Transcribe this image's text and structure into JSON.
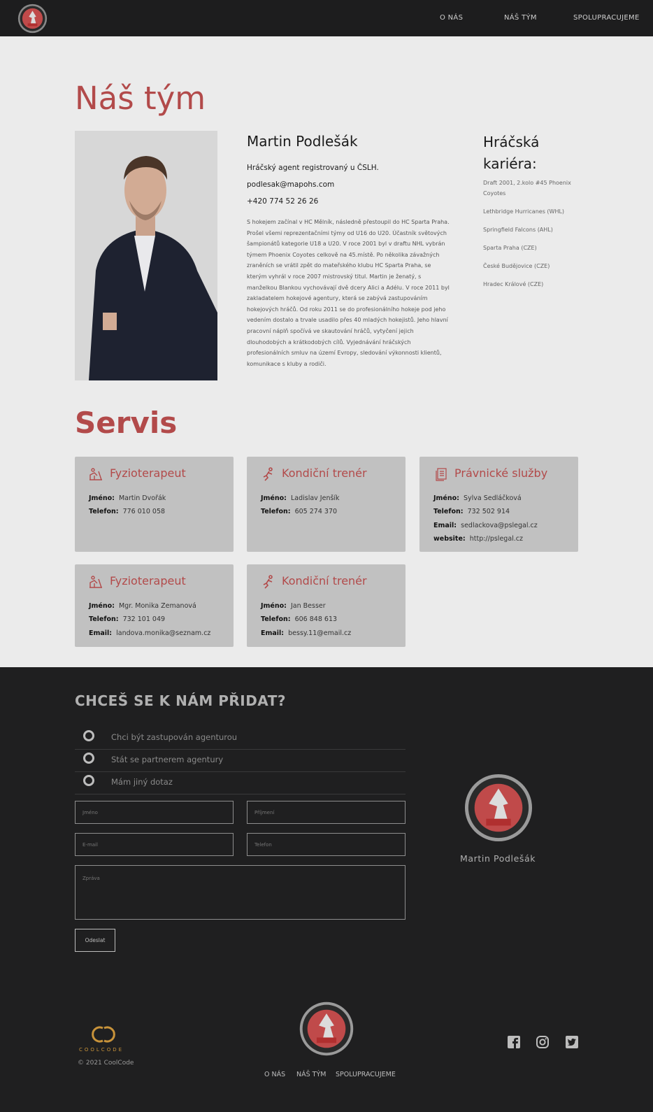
{
  "header": {
    "nav": [
      "O NÁS",
      "NÁŠ TÝM",
      "SPOLUPRACUJEME"
    ]
  },
  "team": {
    "heading": "Náš tým",
    "name": "Martin Podlešák",
    "subtitle": "Hráčský agent registrovaný u ČSLH.",
    "email": "podlesak@mapohs.com",
    "phone": "+420 774 52 26 26",
    "bio": "S hokejem začínal v HC Mělník, následně přestoupil do HC Sparta Praha. Prošel všemi reprezentačními týmy od U16 do U20. Účastník světových šampionátů kategorie U18 a U20. V roce 2001 byl v draftu NHL vybrán týmem Phoenix Coyotes celkově na 45.místě. Po několika závažných zraněních se vrátil zpět do mateřského klubu HC Sparta Praha, se kterým vyhrál v roce 2007 mistrovský titul. Martin je ženatý, s manželkou Blankou vychovávají dvě dcery Alici a Adélu. V roce 2011 byl zakladatelem hokejové agentury, která se zabývá zastupováním hokejových hráčů. Od roku 2011 se do profesionálního hokeje pod jeho vedením dostalo a trvale usadilo přes 40 mladých hokejistů. Jeho hlavní pracovní náplň spočívá ve skautování hráčů, vytyčení jejich dlouhodobých a krátkodobých cílů. Vyjednávání hráčských profesionálních smluv na území Evropy, sledování výkonnosti klientů, komunikace s kluby a rodiči.",
    "career_title": "Hráčská kariéra:",
    "career": [
      "Draft 2001, 2.kolo #45 Phoenix Coyotes",
      "Lethbridge Hurricanes (WHL)",
      "Springfield Falcons (AHL)",
      "Sparta Praha (CZE)",
      "České Budějovice (CZE)",
      "Hradec Králové (CZE)"
    ]
  },
  "servis": {
    "heading": "Servis",
    "cards": [
      {
        "title": "Fyzioterapeut",
        "icon": "physio-icon",
        "rows": [
          [
            "Jméno:",
            "Martin Dvořák"
          ],
          [
            "Telefon:",
            "776 010 058"
          ]
        ]
      },
      {
        "title": "Kondiční trenér",
        "icon": "runner-icon",
        "rows": [
          [
            "Jméno:",
            "Ladislav Jenšík"
          ],
          [
            "Telefon:",
            "605 274 370"
          ]
        ]
      },
      {
        "title": "Právnické služby",
        "icon": "documents-icon",
        "rows": [
          [
            "Jméno:",
            "Sylva Sedláčková"
          ],
          [
            "Telefon:",
            "732 502 914"
          ],
          [
            "Email:",
            "sedlackova@pslegal.cz"
          ],
          [
            "website:",
            "http://pslegal.cz"
          ]
        ]
      },
      {
        "title": "Fyzioterapeut",
        "icon": "physio-icon",
        "rows": [
          [
            "Jméno:",
            "Mgr. Monika Zemanová"
          ],
          [
            "Telefon:",
            "732 101 049"
          ],
          [
            "Email:",
            "landova.monika@seznam.cz"
          ]
        ]
      },
      {
        "title": "Kondiční trenér",
        "icon": "runner-icon",
        "rows": [
          [
            "Jméno:",
            "Jan Besser"
          ],
          [
            "Telefon:",
            "606 848 613"
          ],
          [
            "Email:",
            "bessy.11@email.cz"
          ]
        ]
      }
    ]
  },
  "form": {
    "heading": "CHCEŠ SE K NÁM PŘIDAT?",
    "options": [
      "Chci být zastupován agenturou",
      "Stát se partnerem agentury",
      "Mám jiný dotaz"
    ],
    "placeholders": {
      "first": "Jméno",
      "last": "Příjmení",
      "email": "E-mail",
      "phone": "Telefon",
      "message": "Zpráva"
    },
    "submit": "Odeslat",
    "owner": "Martin Podlešák"
  },
  "footer": {
    "brand": "COOLCODE",
    "copyright": "© 2021 CoolCode",
    "nav": [
      "O NÁS",
      "NÁŠ TÝM",
      "SPOLUPRACUJEME"
    ],
    "social": [
      "facebook-icon",
      "instagram-icon",
      "twitter-icon"
    ]
  },
  "colors": {
    "accent": "#b24a4a",
    "dark": "#1f1f20",
    "light": "#ebebeb",
    "card": "#c1c1c1"
  }
}
